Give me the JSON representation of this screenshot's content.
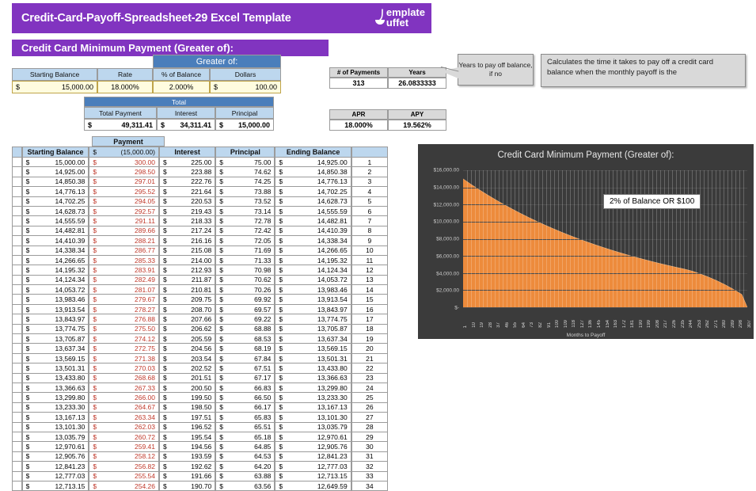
{
  "header": {
    "title": "Credit-Card-Payoff-Spreadsheet-29 Excel Template",
    "logo_line1": "emplate",
    "logo_line2": "uffet",
    "brand_color": "#8134c0"
  },
  "banner": {
    "title": "Credit Card Minimum Payment (Greater of):"
  },
  "inputs": {
    "group_header": "Greater of:",
    "headers": [
      "Starting Balance",
      "Rate",
      "% of Balance",
      "Dollars"
    ],
    "values": {
      "starting_balance_currency": "$",
      "starting_balance": "15,000.00",
      "rate": "18.000%",
      "pct_of_balance": "2.000%",
      "dollars_currency": "$",
      "dollars": "100.00"
    }
  },
  "total": {
    "group_header": "Total",
    "headers": [
      "Total Payment",
      "Interest",
      "Principal"
    ],
    "values": {
      "total_payment_currency": "$",
      "total_payment": "49,311.41",
      "interest_currency": "$",
      "interest": "34,311.41",
      "principal_currency": "$",
      "principal": "15,000.00"
    }
  },
  "payments_table": {
    "headers": [
      "# of Payments",
      "Years"
    ],
    "values": [
      "313",
      "26.0833333"
    ]
  },
  "apr_table": {
    "headers": [
      "APR",
      "APY"
    ],
    "values": [
      "18.000%",
      "19.562%"
    ]
  },
  "callouts": {
    "years": "Years to pay off balance, if no",
    "description": "Calculates the time it takes to pay off a credit card balance when  the monthly payoff is the"
  },
  "amortization": {
    "payment_group_header": "Payment",
    "payment_group_currency": "$",
    "payment_group_value": "(15,000.00)",
    "headers": [
      "Starting Balance",
      "Interest",
      "Principal",
      "Ending Balance"
    ],
    "currency": "$",
    "rows": [
      {
        "start": "15,000.00",
        "payment": "300.00",
        "interest": "225.00",
        "principal": "75.00",
        "ending": "14,925.00",
        "n": "1"
      },
      {
        "start": "14,925.00",
        "payment": "298.50",
        "interest": "223.88",
        "principal": "74.62",
        "ending": "14,850.38",
        "n": "2"
      },
      {
        "start": "14,850.38",
        "payment": "297.01",
        "interest": "222.76",
        "principal": "74.25",
        "ending": "14,776.13",
        "n": "3"
      },
      {
        "start": "14,776.13",
        "payment": "295.52",
        "interest": "221.64",
        "principal": "73.88",
        "ending": "14,702.25",
        "n": "4"
      },
      {
        "start": "14,702.25",
        "payment": "294.05",
        "interest": "220.53",
        "principal": "73.52",
        "ending": "14,628.73",
        "n": "5"
      },
      {
        "start": "14,628.73",
        "payment": "292.57",
        "interest": "219.43",
        "principal": "73.14",
        "ending": "14,555.59",
        "n": "6"
      },
      {
        "start": "14,555.59",
        "payment": "291.11",
        "interest": "218.33",
        "principal": "72.78",
        "ending": "14,482.81",
        "n": "7"
      },
      {
        "start": "14,482.81",
        "payment": "289.66",
        "interest": "217.24",
        "principal": "72.42",
        "ending": "14,410.39",
        "n": "8"
      },
      {
        "start": "14,410.39",
        "payment": "288.21",
        "interest": "216.16",
        "principal": "72.05",
        "ending": "14,338.34",
        "n": "9"
      },
      {
        "start": "14,338.34",
        "payment": "286.77",
        "interest": "215.08",
        "principal": "71.69",
        "ending": "14,266.65",
        "n": "10"
      },
      {
        "start": "14,266.65",
        "payment": "285.33",
        "interest": "214.00",
        "principal": "71.33",
        "ending": "14,195.32",
        "n": "11"
      },
      {
        "start": "14,195.32",
        "payment": "283.91",
        "interest": "212.93",
        "principal": "70.98",
        "ending": "14,124.34",
        "n": "12"
      },
      {
        "start": "14,124.34",
        "payment": "282.49",
        "interest": "211.87",
        "principal": "70.62",
        "ending": "14,053.72",
        "n": "13"
      },
      {
        "start": "14,053.72",
        "payment": "281.07",
        "interest": "210.81",
        "principal": "70.26",
        "ending": "13,983.46",
        "n": "14"
      },
      {
        "start": "13,983.46",
        "payment": "279.67",
        "interest": "209.75",
        "principal": "69.92",
        "ending": "13,913.54",
        "n": "15"
      },
      {
        "start": "13,913.54",
        "payment": "278.27",
        "interest": "208.70",
        "principal": "69.57",
        "ending": "13,843.97",
        "n": "16"
      },
      {
        "start": "13,843.97",
        "payment": "276.88",
        "interest": "207.66",
        "principal": "69.22",
        "ending": "13,774.75",
        "n": "17"
      },
      {
        "start": "13,774.75",
        "payment": "275.50",
        "interest": "206.62",
        "principal": "68.88",
        "ending": "13,705.87",
        "n": "18"
      },
      {
        "start": "13,705.87",
        "payment": "274.12",
        "interest": "205.59",
        "principal": "68.53",
        "ending": "13,637.34",
        "n": "19"
      },
      {
        "start": "13,637.34",
        "payment": "272.75",
        "interest": "204.56",
        "principal": "68.19",
        "ending": "13,569.15",
        "n": "20"
      },
      {
        "start": "13,569.15",
        "payment": "271.38",
        "interest": "203.54",
        "principal": "67.84",
        "ending": "13,501.31",
        "n": "21"
      },
      {
        "start": "13,501.31",
        "payment": "270.03",
        "interest": "202.52",
        "principal": "67.51",
        "ending": "13,433.80",
        "n": "22"
      },
      {
        "start": "13,433.80",
        "payment": "268.68",
        "interest": "201.51",
        "principal": "67.17",
        "ending": "13,366.63",
        "n": "23"
      },
      {
        "start": "13,366.63",
        "payment": "267.33",
        "interest": "200.50",
        "principal": "66.83",
        "ending": "13,299.80",
        "n": "24"
      },
      {
        "start": "13,299.80",
        "payment": "266.00",
        "interest": "199.50",
        "principal": "66.50",
        "ending": "13,233.30",
        "n": "25"
      },
      {
        "start": "13,233.30",
        "payment": "264.67",
        "interest": "198.50",
        "principal": "66.17",
        "ending": "13,167.13",
        "n": "26"
      },
      {
        "start": "13,167.13",
        "payment": "263.34",
        "interest": "197.51",
        "principal": "65.83",
        "ending": "13,101.30",
        "n": "27"
      },
      {
        "start": "13,101.30",
        "payment": "262.03",
        "interest": "196.52",
        "principal": "65.51",
        "ending": "13,035.79",
        "n": "28"
      },
      {
        "start": "13,035.79",
        "payment": "260.72",
        "interest": "195.54",
        "principal": "65.18",
        "ending": "12,970.61",
        "n": "29"
      },
      {
        "start": "12,970.61",
        "payment": "259.41",
        "interest": "194.56",
        "principal": "64.85",
        "ending": "12,905.76",
        "n": "30"
      },
      {
        "start": "12,905.76",
        "payment": "258.12",
        "interest": "193.59",
        "principal": "64.53",
        "ending": "12,841.23",
        "n": "31"
      },
      {
        "start": "12,841.23",
        "payment": "256.82",
        "interest": "192.62",
        "principal": "64.20",
        "ending": "12,777.03",
        "n": "32"
      },
      {
        "start": "12,777.03",
        "payment": "255.54",
        "interest": "191.66",
        "principal": "63.88",
        "ending": "12,713.15",
        "n": "33"
      },
      {
        "start": "12,713.15",
        "payment": "254.26",
        "interest": "190.70",
        "principal": "63.56",
        "ending": "12,649.59",
        "n": "34"
      }
    ]
  },
  "chart_data": {
    "type": "area",
    "title": "Credit Card Minimum Payment (Greater of):",
    "xlabel": "Months to Payoff",
    "ylabel": "",
    "annotation": "2% of Balance OR $100",
    "series_color": "#ed8b3c",
    "background": "#3b3b3b",
    "grid": true,
    "legend": "none",
    "ylim": [
      0,
      16000
    ],
    "yticks": [
      "$-",
      "$2,000.00",
      "$4,000.00",
      "$6,000.00",
      "$8,000.00",
      "$10,000.00",
      "$12,000.00",
      "$14,000.00",
      "$16,000.00"
    ],
    "ytick_values": [
      0,
      2000,
      4000,
      6000,
      8000,
      10000,
      12000,
      14000,
      16000
    ],
    "xticks": [
      "1",
      "10",
      "19",
      "28",
      "37",
      "46",
      "55",
      "64",
      "73",
      "82",
      "91",
      "100",
      "109",
      "118",
      "127",
      "136",
      "145",
      "154",
      "163",
      "172",
      "181",
      "190",
      "199",
      "208",
      "217",
      "226",
      "235",
      "244",
      "253",
      "262",
      "271",
      "280",
      "289",
      "298",
      "307"
    ],
    "x": [
      1,
      10,
      19,
      28,
      37,
      46,
      55,
      64,
      73,
      82,
      91,
      100,
      109,
      118,
      127,
      136,
      145,
      154,
      163,
      172,
      181,
      190,
      199,
      208,
      217,
      226,
      235,
      244,
      253,
      262,
      271,
      280,
      289,
      298,
      307,
      313
    ],
    "values": [
      15000,
      14338,
      13712,
      13113,
      12541,
      11993,
      11470,
      10969,
      10491,
      10033,
      9595,
      9177,
      8776,
      8393,
      8026,
      7675,
      7339,
      7017,
      6709,
      6414,
      6131,
      5861,
      5602,
      5353,
      5116,
      4888,
      4670,
      4462,
      4211,
      3876,
      3502,
      3083,
      2614,
      2088,
      1498,
      0
    ]
  }
}
